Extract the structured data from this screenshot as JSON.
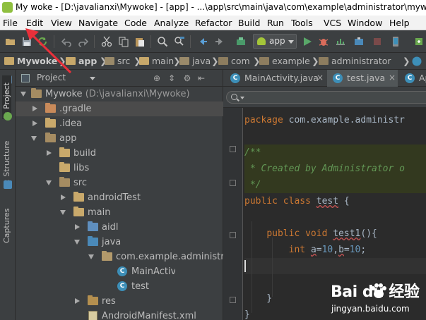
{
  "window": {
    "title": "My woke - [D:\\javalianxi\\Mywoke] - [app] - ...\\app\\src\\main\\java\\com\\example\\administrator\\mywok"
  },
  "menu": [
    "File",
    "Edit",
    "View",
    "Navigate",
    "Code",
    "Analyze",
    "Refactor",
    "Build",
    "Run",
    "Tools",
    "VCS",
    "Window",
    "Help"
  ],
  "toolbar": {
    "run_config": "app",
    "icons": [
      "open-folder-icon",
      "save-all-icon",
      "sync-icon",
      "undo-icon",
      "redo-icon",
      "cut-icon",
      "copy-icon",
      "paste-icon",
      "find-icon",
      "replace-icon",
      "back-icon",
      "forward-icon",
      "make-project-icon",
      "run-icon",
      "debug-icon",
      "sdk-manager-icon"
    ]
  },
  "breadcrumbs": [
    "Mywoke",
    "app",
    "src",
    "main",
    "java",
    "com",
    "example",
    "administrator"
  ],
  "side_tabs": [
    "1: Project",
    "2: Structure",
    "Captures"
  ],
  "project_panel": {
    "view_mode": "Project",
    "tree": [
      {
        "label": "Mywoke",
        "suffix": "(D:\\javalianxi\\Mywoke)",
        "type": "module",
        "expanded": true,
        "depth": 0
      },
      {
        "label": ".gradle",
        "type": "folder",
        "expanded": false,
        "depth": 1,
        "selected": true
      },
      {
        "label": ".idea",
        "type": "folder",
        "expanded": false,
        "depth": 1
      },
      {
        "label": "app",
        "type": "module",
        "expanded": true,
        "depth": 1
      },
      {
        "label": "build",
        "type": "folder",
        "expanded": false,
        "depth": 2
      },
      {
        "label": "libs",
        "type": "folder",
        "depth": 2
      },
      {
        "label": "src",
        "type": "src",
        "expanded": true,
        "depth": 2
      },
      {
        "label": "androidTest",
        "type": "folder",
        "expanded": false,
        "depth": 3
      },
      {
        "label": "main",
        "type": "folder",
        "expanded": true,
        "depth": 3
      },
      {
        "label": "aidl",
        "type": "aidl",
        "expanded": false,
        "depth": 4
      },
      {
        "label": "java",
        "type": "java",
        "expanded": true,
        "depth": 4
      },
      {
        "label": "com.example.administrato",
        "type": "package",
        "expanded": true,
        "depth": 5
      },
      {
        "label": "MainActivity",
        "type": "class",
        "depth": 6
      },
      {
        "label": "test",
        "type": "class",
        "depth": 6
      },
      {
        "label": "res",
        "type": "res",
        "expanded": false,
        "depth": 4
      },
      {
        "label": "AndroidManifest.xml",
        "type": "xml",
        "depth": 4
      }
    ]
  },
  "editor": {
    "tabs": [
      {
        "label": "MainActivity.java",
        "active": false
      },
      {
        "label": "test.java",
        "active": true
      },
      {
        "label": "Ap",
        "active": false
      }
    ],
    "code": [
      [
        {
          "c": "kw",
          "t": "package "
        },
        {
          "c": "pl",
          "t": "com.example.administr"
        }
      ],
      [],
      [
        {
          "c": "cm",
          "t": "/**"
        }
      ],
      [
        {
          "c": "cm",
          "t": " * Created by Administrator o"
        }
      ],
      [
        {
          "c": "cm",
          "t": " */"
        }
      ],
      [
        {
          "c": "kw",
          "t": "public class "
        },
        {
          "c": "var",
          "t": "test"
        },
        {
          "c": "pl",
          "t": " {"
        }
      ],
      [],
      [
        {
          "c": "pl",
          "t": "    "
        },
        {
          "c": "kw",
          "t": "public void "
        },
        {
          "c": "var",
          "t": "test1"
        },
        {
          "c": "pl",
          "t": "(){"
        }
      ],
      [
        {
          "c": "pl",
          "t": "        "
        },
        {
          "c": "kw",
          "t": "int "
        },
        {
          "c": "var",
          "t": "a"
        },
        {
          "c": "pl",
          "t": "="
        },
        {
          "c": "nm",
          "t": "10"
        },
        {
          "c": "pl",
          "t": ","
        },
        {
          "c": "var",
          "t": "b"
        },
        {
          "c": "pl",
          "t": "="
        },
        {
          "c": "nm",
          "t": "10"
        },
        {
          "c": "pl",
          "t": ";"
        }
      ],
      [],
      [],
      [
        {
          "c": "pl",
          "t": "    }"
        }
      ],
      [
        {
          "c": "pl",
          "t": "}"
        }
      ]
    ]
  },
  "watermark": {
    "brand": "Bai du 经验",
    "url": "jingyan.baidu.com"
  },
  "colors": {
    "annotation_arrow": "#e8303a",
    "titlebar_bg": "#ffffff",
    "menubar_bg": "#f2f2f2",
    "ide_bg": "#3c3f41",
    "editor_bg": "#2b2b2b"
  }
}
